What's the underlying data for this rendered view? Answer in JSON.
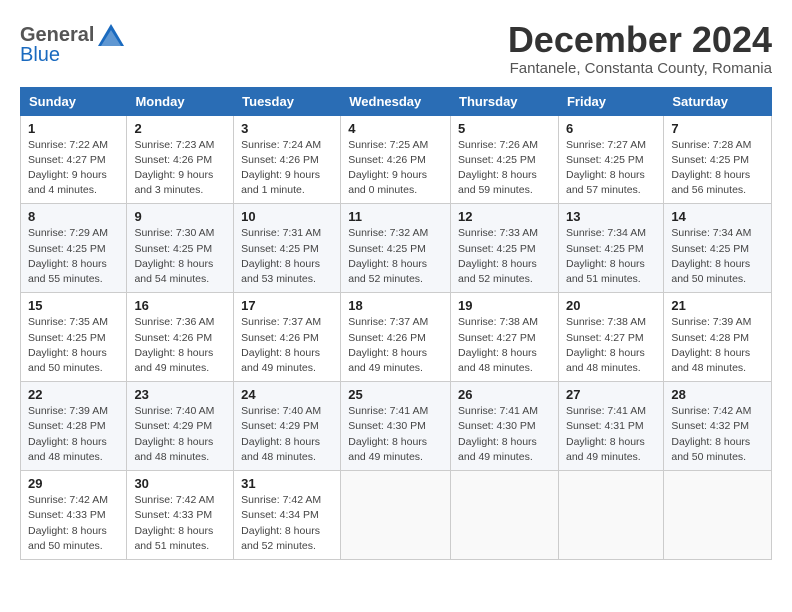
{
  "header": {
    "logo_general": "General",
    "logo_blue": "Blue",
    "month_title": "December 2024",
    "location": "Fantanele, Constanta County, Romania"
  },
  "weekdays": [
    "Sunday",
    "Monday",
    "Tuesday",
    "Wednesday",
    "Thursday",
    "Friday",
    "Saturday"
  ],
  "weeks": [
    [
      {
        "day": "1",
        "sunrise": "Sunrise: 7:22 AM",
        "sunset": "Sunset: 4:27 PM",
        "daylight": "Daylight: 9 hours and 4 minutes."
      },
      {
        "day": "2",
        "sunrise": "Sunrise: 7:23 AM",
        "sunset": "Sunset: 4:26 PM",
        "daylight": "Daylight: 9 hours and 3 minutes."
      },
      {
        "day": "3",
        "sunrise": "Sunrise: 7:24 AM",
        "sunset": "Sunset: 4:26 PM",
        "daylight": "Daylight: 9 hours and 1 minute."
      },
      {
        "day": "4",
        "sunrise": "Sunrise: 7:25 AM",
        "sunset": "Sunset: 4:26 PM",
        "daylight": "Daylight: 9 hours and 0 minutes."
      },
      {
        "day": "5",
        "sunrise": "Sunrise: 7:26 AM",
        "sunset": "Sunset: 4:25 PM",
        "daylight": "Daylight: 8 hours and 59 minutes."
      },
      {
        "day": "6",
        "sunrise": "Sunrise: 7:27 AM",
        "sunset": "Sunset: 4:25 PM",
        "daylight": "Daylight: 8 hours and 57 minutes."
      },
      {
        "day": "7",
        "sunrise": "Sunrise: 7:28 AM",
        "sunset": "Sunset: 4:25 PM",
        "daylight": "Daylight: 8 hours and 56 minutes."
      }
    ],
    [
      {
        "day": "8",
        "sunrise": "Sunrise: 7:29 AM",
        "sunset": "Sunset: 4:25 PM",
        "daylight": "Daylight: 8 hours and 55 minutes."
      },
      {
        "day": "9",
        "sunrise": "Sunrise: 7:30 AM",
        "sunset": "Sunset: 4:25 PM",
        "daylight": "Daylight: 8 hours and 54 minutes."
      },
      {
        "day": "10",
        "sunrise": "Sunrise: 7:31 AM",
        "sunset": "Sunset: 4:25 PM",
        "daylight": "Daylight: 8 hours and 53 minutes."
      },
      {
        "day": "11",
        "sunrise": "Sunrise: 7:32 AM",
        "sunset": "Sunset: 4:25 PM",
        "daylight": "Daylight: 8 hours and 52 minutes."
      },
      {
        "day": "12",
        "sunrise": "Sunrise: 7:33 AM",
        "sunset": "Sunset: 4:25 PM",
        "daylight": "Daylight: 8 hours and 52 minutes."
      },
      {
        "day": "13",
        "sunrise": "Sunrise: 7:34 AM",
        "sunset": "Sunset: 4:25 PM",
        "daylight": "Daylight: 8 hours and 51 minutes."
      },
      {
        "day": "14",
        "sunrise": "Sunrise: 7:34 AM",
        "sunset": "Sunset: 4:25 PM",
        "daylight": "Daylight: 8 hours and 50 minutes."
      }
    ],
    [
      {
        "day": "15",
        "sunrise": "Sunrise: 7:35 AM",
        "sunset": "Sunset: 4:25 PM",
        "daylight": "Daylight: 8 hours and 50 minutes."
      },
      {
        "day": "16",
        "sunrise": "Sunrise: 7:36 AM",
        "sunset": "Sunset: 4:26 PM",
        "daylight": "Daylight: 8 hours and 49 minutes."
      },
      {
        "day": "17",
        "sunrise": "Sunrise: 7:37 AM",
        "sunset": "Sunset: 4:26 PM",
        "daylight": "Daylight: 8 hours and 49 minutes."
      },
      {
        "day": "18",
        "sunrise": "Sunrise: 7:37 AM",
        "sunset": "Sunset: 4:26 PM",
        "daylight": "Daylight: 8 hours and 49 minutes."
      },
      {
        "day": "19",
        "sunrise": "Sunrise: 7:38 AM",
        "sunset": "Sunset: 4:27 PM",
        "daylight": "Daylight: 8 hours and 48 minutes."
      },
      {
        "day": "20",
        "sunrise": "Sunrise: 7:38 AM",
        "sunset": "Sunset: 4:27 PM",
        "daylight": "Daylight: 8 hours and 48 minutes."
      },
      {
        "day": "21",
        "sunrise": "Sunrise: 7:39 AM",
        "sunset": "Sunset: 4:28 PM",
        "daylight": "Daylight: 8 hours and 48 minutes."
      }
    ],
    [
      {
        "day": "22",
        "sunrise": "Sunrise: 7:39 AM",
        "sunset": "Sunset: 4:28 PM",
        "daylight": "Daylight: 8 hours and 48 minutes."
      },
      {
        "day": "23",
        "sunrise": "Sunrise: 7:40 AM",
        "sunset": "Sunset: 4:29 PM",
        "daylight": "Daylight: 8 hours and 48 minutes."
      },
      {
        "day": "24",
        "sunrise": "Sunrise: 7:40 AM",
        "sunset": "Sunset: 4:29 PM",
        "daylight": "Daylight: 8 hours and 48 minutes."
      },
      {
        "day": "25",
        "sunrise": "Sunrise: 7:41 AM",
        "sunset": "Sunset: 4:30 PM",
        "daylight": "Daylight: 8 hours and 49 minutes."
      },
      {
        "day": "26",
        "sunrise": "Sunrise: 7:41 AM",
        "sunset": "Sunset: 4:30 PM",
        "daylight": "Daylight: 8 hours and 49 minutes."
      },
      {
        "day": "27",
        "sunrise": "Sunrise: 7:41 AM",
        "sunset": "Sunset: 4:31 PM",
        "daylight": "Daylight: 8 hours and 49 minutes."
      },
      {
        "day": "28",
        "sunrise": "Sunrise: 7:42 AM",
        "sunset": "Sunset: 4:32 PM",
        "daylight": "Daylight: 8 hours and 50 minutes."
      }
    ],
    [
      {
        "day": "29",
        "sunrise": "Sunrise: 7:42 AM",
        "sunset": "Sunset: 4:33 PM",
        "daylight": "Daylight: 8 hours and 50 minutes."
      },
      {
        "day": "30",
        "sunrise": "Sunrise: 7:42 AM",
        "sunset": "Sunset: 4:33 PM",
        "daylight": "Daylight: 8 hours and 51 minutes."
      },
      {
        "day": "31",
        "sunrise": "Sunrise: 7:42 AM",
        "sunset": "Sunset: 4:34 PM",
        "daylight": "Daylight: 8 hours and 52 minutes."
      },
      null,
      null,
      null,
      null
    ]
  ]
}
